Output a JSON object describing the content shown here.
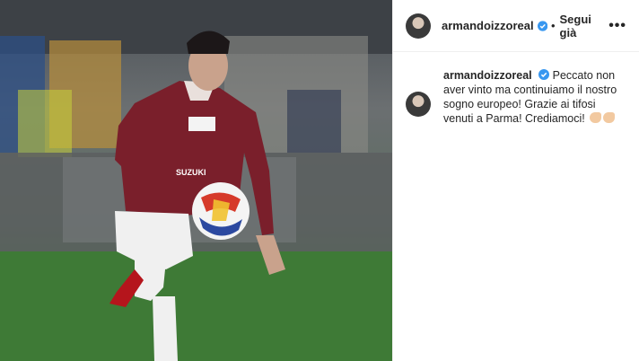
{
  "post": {
    "username": "armandoizzoreal",
    "dot": "•",
    "follow_label": "Segui già",
    "more_label": "•••",
    "caption_text": "Peccato non aver vinto ma continuiamo il nostro sogno europeo! Grazie ai tifosi venuti a Parma! Crediamoci!",
    "jersey_brand": "SUZUKI"
  },
  "colors": {
    "verified": "#3897f0",
    "text": "#262626",
    "jersey": "#7a1f2b"
  }
}
